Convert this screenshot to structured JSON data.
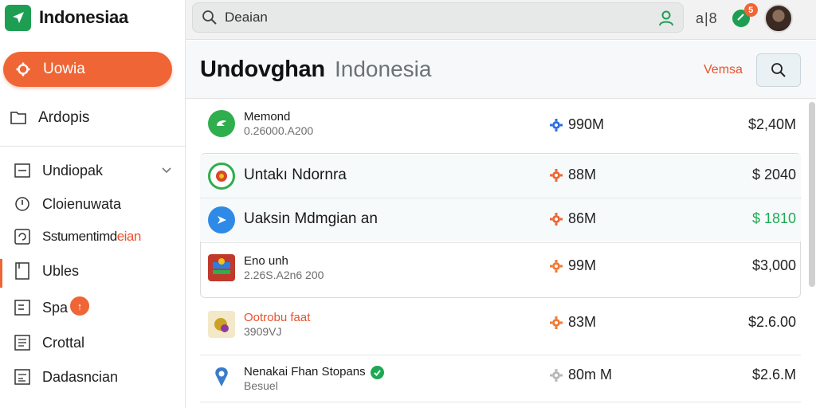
{
  "app": {
    "name": "Indonesiaa",
    "accent": "#ef6535",
    "brand_color": "#1e9e53"
  },
  "sidebar": {
    "primary_button": "Uowia",
    "top_item": "Ardopis",
    "items": [
      {
        "label": "Undiopak",
        "icon": "list-icon",
        "has_chevron": true
      },
      {
        "label": "Cloienuwata",
        "icon": "info-icon"
      },
      {
        "label_main": "Sstumentimd",
        "label_highlight": "eian",
        "icon": "refresh-icon"
      },
      {
        "label": "Ubles",
        "icon": "book-icon",
        "active": true
      },
      {
        "label": "Spa",
        "icon": "list-icon",
        "badge": "↑"
      },
      {
        "label": "Crottal",
        "icon": "document-icon"
      },
      {
        "label": "Dadasncian",
        "icon": "chart-icon"
      }
    ]
  },
  "topbar": {
    "search_value": "Deaian",
    "sync_text": "a|8",
    "notifications_badge": "5"
  },
  "header": {
    "title": "Undovghan",
    "subtitle": "Indonesia",
    "link": "Vemsa"
  },
  "list": {
    "rows": [
      {
        "name": "Memond",
        "sub": "0.26000.A200",
        "metric": "990M",
        "price": "$2,40M",
        "metric_color": "#2e6fe0",
        "icon_color": "#2fae4e",
        "price_color": "#222222"
      },
      {
        "name": "Untakı Ndornra",
        "sub": "",
        "metric": "88M",
        "price": "$ 2040",
        "metric_color": "#ef6535",
        "icon_color": "#d9472b",
        "price_color": "#222222"
      },
      {
        "name": "Uaksin Mdmgian an",
        "sub": "",
        "metric": "86M",
        "price": "$ 1810",
        "metric_color": "#ef6535",
        "icon_color": "#2e8ae6",
        "price_color": "#1ea854"
      },
      {
        "name": "Eno unh",
        "sub": "2.26S.A2n6 200",
        "metric": "99M",
        "price": "$3,000",
        "metric_color": "#ef7a35",
        "icon_color": "#c0392b",
        "price_color": "#222222"
      },
      {
        "name": "Ootrobu faat",
        "sub": "3909VJ",
        "metric": "83M",
        "price": "$2.6.00",
        "metric_color": "#ef7a35",
        "icon_color": "#c9a227",
        "price_color": "#222222"
      },
      {
        "name": "Nenakai Fhan Stopans",
        "sub": "Besuel",
        "metric": "80m M",
        "price": "$2.6.M",
        "metric_color": "#b8b8b8",
        "icon_color": "#3a7cc9",
        "price_color": "#222222",
        "verified": true
      }
    ]
  }
}
